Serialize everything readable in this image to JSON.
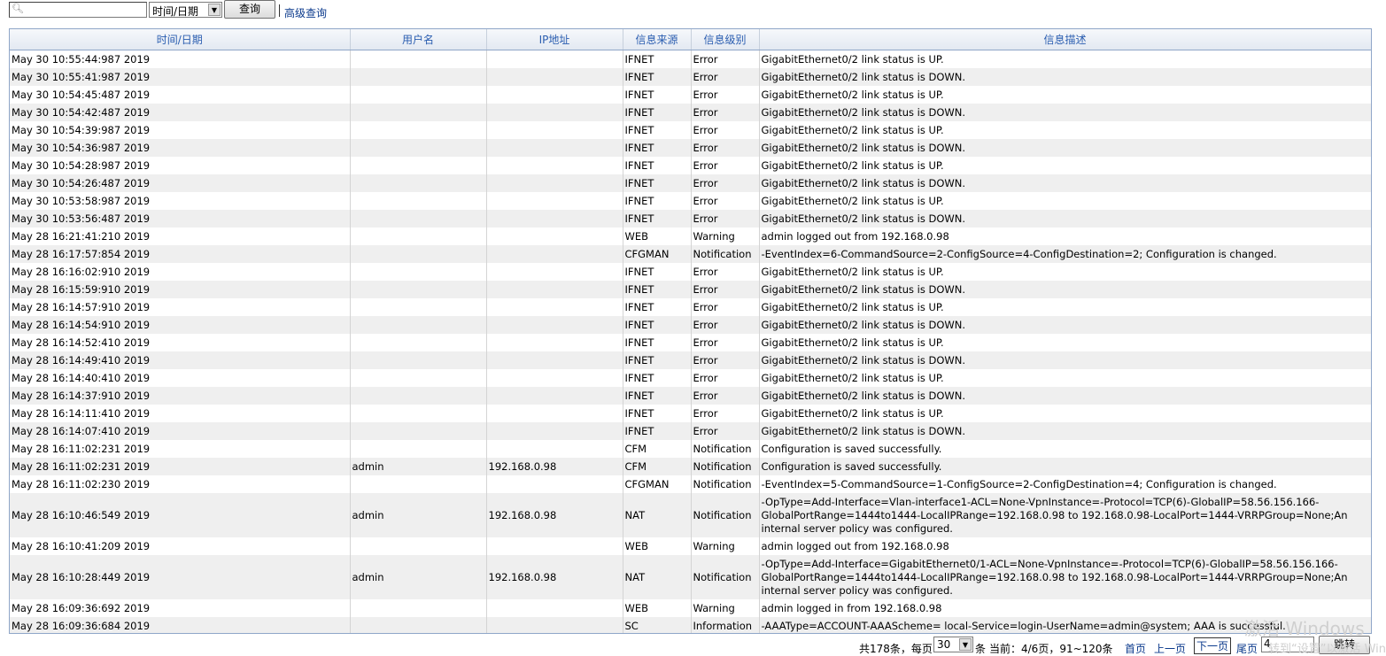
{
  "toolbar": {
    "search_value": "",
    "field_selected": "时间/日期",
    "query_label": "查询",
    "advanced_label": "高级查询"
  },
  "columns": [
    "时间/日期",
    "用户名",
    "IP地址",
    "信息来源",
    "信息级别",
    "信息描述"
  ],
  "rows": [
    {
      "time": "May 30 10:55:44:987 2019",
      "user": "",
      "ip": "",
      "source": "IFNET",
      "level": "Error",
      "desc": "GigabitEthernet0/2 link status is UP."
    },
    {
      "time": "May 30 10:55:41:987 2019",
      "user": "",
      "ip": "",
      "source": "IFNET",
      "level": "Error",
      "desc": "GigabitEthernet0/2 link status is DOWN."
    },
    {
      "time": "May 30 10:54:45:487 2019",
      "user": "",
      "ip": "",
      "source": "IFNET",
      "level": "Error",
      "desc": "GigabitEthernet0/2 link status is UP."
    },
    {
      "time": "May 30 10:54:42:487 2019",
      "user": "",
      "ip": "",
      "source": "IFNET",
      "level": "Error",
      "desc": "GigabitEthernet0/2 link status is DOWN."
    },
    {
      "time": "May 30 10:54:39:987 2019",
      "user": "",
      "ip": "",
      "source": "IFNET",
      "level": "Error",
      "desc": "GigabitEthernet0/2 link status is UP."
    },
    {
      "time": "May 30 10:54:36:987 2019",
      "user": "",
      "ip": "",
      "source": "IFNET",
      "level": "Error",
      "desc": "GigabitEthernet0/2 link status is DOWN."
    },
    {
      "time": "May 30 10:54:28:987 2019",
      "user": "",
      "ip": "",
      "source": "IFNET",
      "level": "Error",
      "desc": "GigabitEthernet0/2 link status is UP."
    },
    {
      "time": "May 30 10:54:26:487 2019",
      "user": "",
      "ip": "",
      "source": "IFNET",
      "level": "Error",
      "desc": "GigabitEthernet0/2 link status is DOWN."
    },
    {
      "time": "May 30 10:53:58:987 2019",
      "user": "",
      "ip": "",
      "source": "IFNET",
      "level": "Error",
      "desc": "GigabitEthernet0/2 link status is UP."
    },
    {
      "time": "May 30 10:53:56:487 2019",
      "user": "",
      "ip": "",
      "source": "IFNET",
      "level": "Error",
      "desc": "GigabitEthernet0/2 link status is DOWN."
    },
    {
      "time": "May 28 16:21:41:210 2019",
      "user": "",
      "ip": "",
      "source": "WEB",
      "level": "Warning",
      "desc": "admin logged out from 192.168.0.98"
    },
    {
      "time": "May 28 16:17:57:854 2019",
      "user": "",
      "ip": "",
      "source": "CFGMAN",
      "level": "Notification",
      "desc": "-EventIndex=6-CommandSource=2-ConfigSource=4-ConfigDestination=2; Configuration is changed."
    },
    {
      "time": "May 28 16:16:02:910 2019",
      "user": "",
      "ip": "",
      "source": "IFNET",
      "level": "Error",
      "desc": "GigabitEthernet0/2 link status is UP."
    },
    {
      "time": "May 28 16:15:59:910 2019",
      "user": "",
      "ip": "",
      "source": "IFNET",
      "level": "Error",
      "desc": "GigabitEthernet0/2 link status is DOWN."
    },
    {
      "time": "May 28 16:14:57:910 2019",
      "user": "",
      "ip": "",
      "source": "IFNET",
      "level": "Error",
      "desc": "GigabitEthernet0/2 link status is UP."
    },
    {
      "time": "May 28 16:14:54:910 2019",
      "user": "",
      "ip": "",
      "source": "IFNET",
      "level": "Error",
      "desc": "GigabitEthernet0/2 link status is DOWN."
    },
    {
      "time": "May 28 16:14:52:410 2019",
      "user": "",
      "ip": "",
      "source": "IFNET",
      "level": "Error",
      "desc": "GigabitEthernet0/2 link status is UP."
    },
    {
      "time": "May 28 16:14:49:410 2019",
      "user": "",
      "ip": "",
      "source": "IFNET",
      "level": "Error",
      "desc": "GigabitEthernet0/2 link status is DOWN."
    },
    {
      "time": "May 28 16:14:40:410 2019",
      "user": "",
      "ip": "",
      "source": "IFNET",
      "level": "Error",
      "desc": "GigabitEthernet0/2 link status is UP."
    },
    {
      "time": "May 28 16:14:37:910 2019",
      "user": "",
      "ip": "",
      "source": "IFNET",
      "level": "Error",
      "desc": "GigabitEthernet0/2 link status is DOWN."
    },
    {
      "time": "May 28 16:14:11:410 2019",
      "user": "",
      "ip": "",
      "source": "IFNET",
      "level": "Error",
      "desc": "GigabitEthernet0/2 link status is UP."
    },
    {
      "time": "May 28 16:14:07:410 2019",
      "user": "",
      "ip": "",
      "source": "IFNET",
      "level": "Error",
      "desc": "GigabitEthernet0/2 link status is DOWN."
    },
    {
      "time": "May 28 16:11:02:231 2019",
      "user": "",
      "ip": "",
      "source": "CFM",
      "level": "Notification",
      "desc": "Configuration is saved successfully."
    },
    {
      "time": "May 28 16:11:02:231 2019",
      "user": "admin",
      "ip": "192.168.0.98",
      "source": "CFM",
      "level": "Notification",
      "desc": "Configuration is saved successfully."
    },
    {
      "time": "May 28 16:11:02:230 2019",
      "user": "",
      "ip": "",
      "source": "CFGMAN",
      "level": "Notification",
      "desc": "-EventIndex=5-CommandSource=1-ConfigSource=2-ConfigDestination=4; Configuration is changed."
    },
    {
      "time": "May 28 16:10:46:549 2019",
      "user": "admin",
      "ip": "192.168.0.98",
      "source": "NAT",
      "level": "Notification",
      "desc": "-OpType=Add-Interface=Vlan-interface1-ACL=None-VpnInstance=-Protocol=TCP(6)-GlobalIP=58.56.156.166-GlobalPortRange=1444to1444-LocalIPRange=192.168.0.98 to 192.168.0.98-LocalPort=1444-VRRPGroup=None;An internal server policy was configured.",
      "tall": true
    },
    {
      "time": "May 28 16:10:41:209 2019",
      "user": "",
      "ip": "",
      "source": "WEB",
      "level": "Warning",
      "desc": "admin logged out from 192.168.0.98"
    },
    {
      "time": "May 28 16:10:28:449 2019",
      "user": "admin",
      "ip": "192.168.0.98",
      "source": "NAT",
      "level": "Notification",
      "desc": "-OpType=Add-Interface=GigabitEthernet0/1-ACL=None-VpnInstance=-Protocol=TCP(6)-GlobalIP=58.56.156.166-GlobalPortRange=1444to1444-LocalIPRange=192.168.0.98 to 192.168.0.98-LocalPort=1444-VRRPGroup=None;An internal server policy was configured.",
      "tall": true
    },
    {
      "time": "May 28 16:09:36:692 2019",
      "user": "",
      "ip": "",
      "source": "WEB",
      "level": "Warning",
      "desc": "admin logged in from 192.168.0.98"
    },
    {
      "time": "May 28 16:09:36:684 2019",
      "user": "",
      "ip": "",
      "source": "SC",
      "level": "Information",
      "desc": "-AAAType=ACCOUNT-AAAScheme= local-Service=login-UserName=admin@system; AAA is successful."
    }
  ],
  "pager": {
    "total": "共178条，每页",
    "per_page": "30",
    "unit": "条",
    "current": "当前：4/6页，91~120条",
    "first": "首页",
    "prev": "上一页",
    "next": "下一页",
    "last": "尾页",
    "jump_value": "4",
    "jump_label": "跳转"
  },
  "watermark": {
    "line1": "激活 Windows",
    "line2": "转到“设置”以激活 Windows。"
  }
}
